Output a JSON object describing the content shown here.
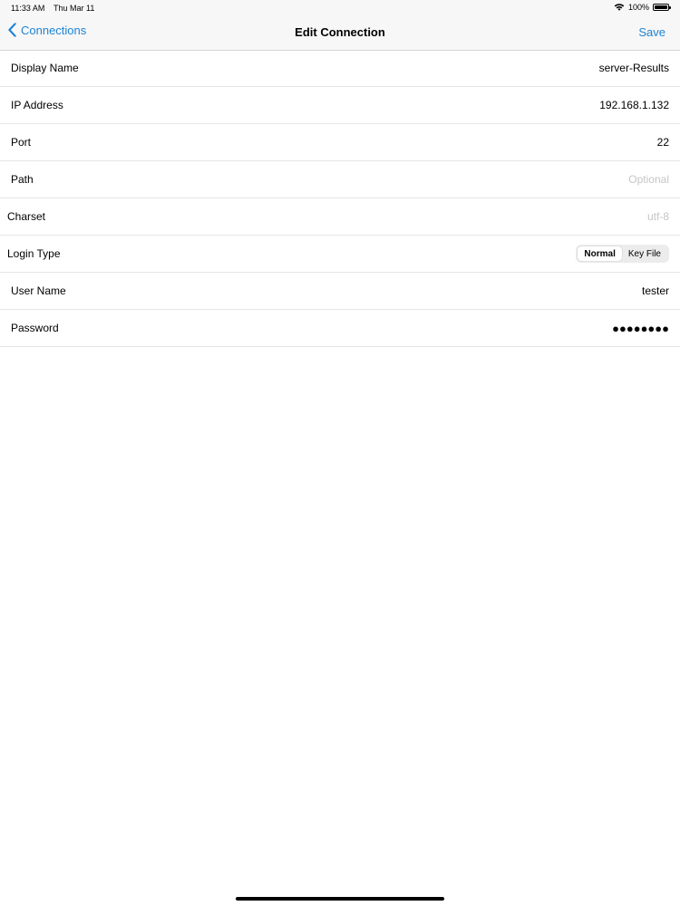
{
  "status_bar": {
    "time": "11:33 AM",
    "date": "Thu Mar 11",
    "battery": "100%"
  },
  "nav": {
    "back_label": "Connections",
    "title": "Edit Connection",
    "save_label": "Save"
  },
  "form": {
    "display_name": {
      "label": "Display Name",
      "value": "server-Results"
    },
    "ip_address": {
      "label": "IP Address",
      "value": "192.168.1.132"
    },
    "port": {
      "label": "Port",
      "value": "22"
    },
    "path": {
      "label": "Path",
      "placeholder": "Optional"
    },
    "charset": {
      "label": "Charset",
      "value": "utf-8"
    },
    "login_type": {
      "label": "Login Type",
      "options": [
        "Normal",
        "Key File"
      ],
      "selected": "Normal"
    },
    "user_name": {
      "label": "User Name",
      "value": "tester"
    },
    "password": {
      "label": "Password",
      "value": "●●●●●●●●"
    }
  },
  "colors": {
    "accent": "#1d83d6",
    "placeholder": "#c5c5c5",
    "separator": "#e6e6e6"
  }
}
